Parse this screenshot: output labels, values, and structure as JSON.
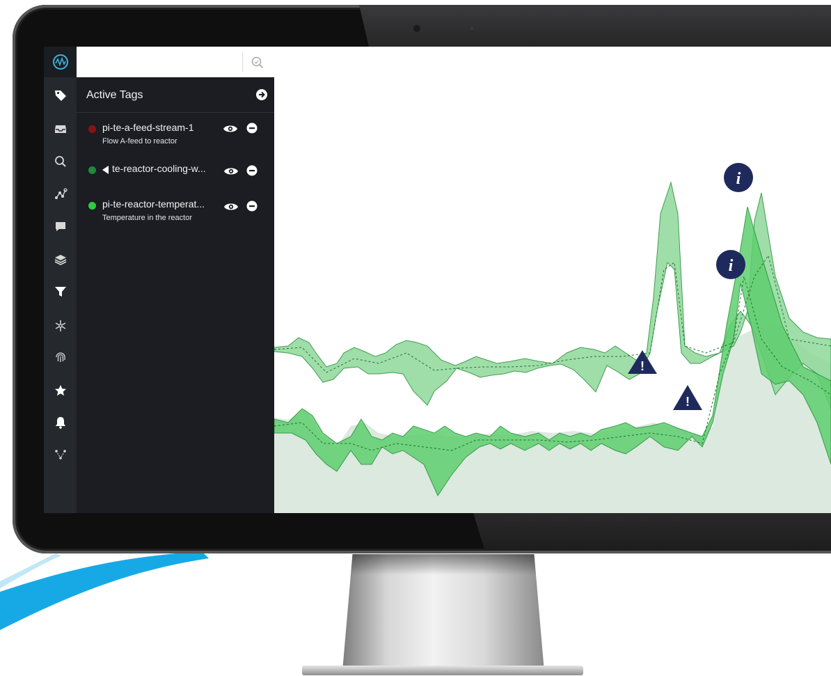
{
  "search": {
    "placeholder": "",
    "value": ""
  },
  "panel": {
    "title": "Active Tags"
  },
  "tags": [
    {
      "name": "pi-te-a-feed-stream-1",
      "description": "Flow A-feed to reactor",
      "color": "#8b1212",
      "collapsed": false
    },
    {
      "name": "te-reactor-cooling-w...",
      "description": "",
      "color": "#1e8a3c",
      "collapsed": true
    },
    {
      "name": "pi-te-reactor-temperat...",
      "description": "Temperature in the reactor",
      "color": "#2ecc40",
      "collapsed": false
    }
  ],
  "rail_icons": [
    "tag-icon",
    "inbox-icon",
    "search-icon",
    "graph-icon",
    "comment-icon",
    "layers-icon",
    "filter-icon",
    "snowflake-icon",
    "fingerprint-icon",
    "star-icon",
    "bell-icon",
    "network-icon"
  ],
  "markers": {
    "info_label": "i",
    "warning_label": "!"
  },
  "colors": {
    "accent": "#1f2a5c",
    "band_fill": "#5fcf6f",
    "band_fill_light": "#8fd99a",
    "area_fill": "#dbe9de",
    "line": "#1f8c33"
  }
}
